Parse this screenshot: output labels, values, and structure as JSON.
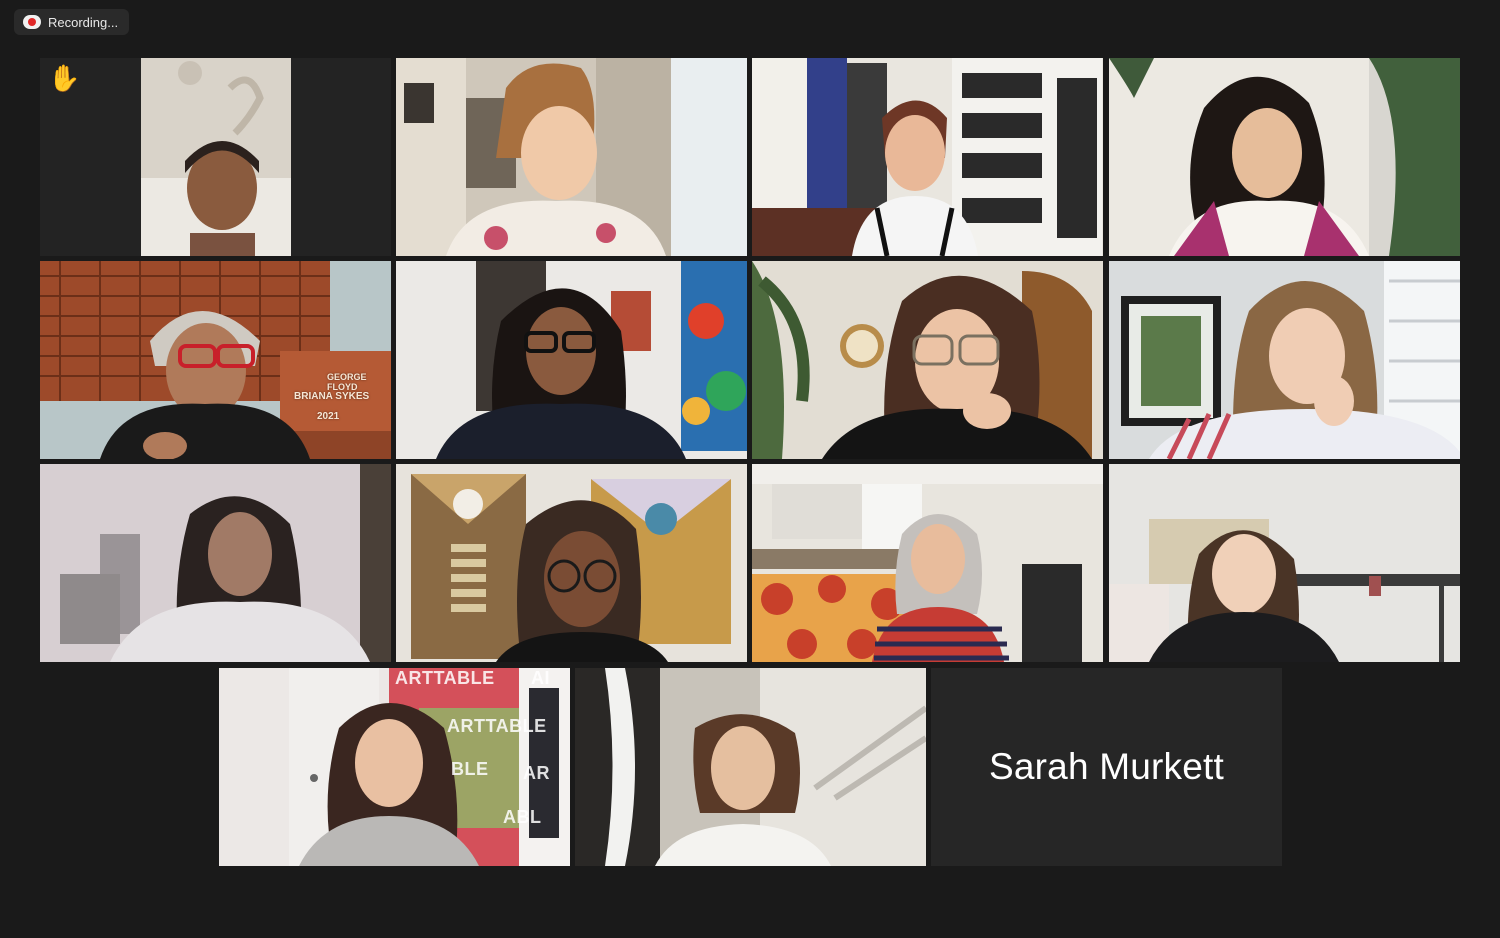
{
  "app": {
    "recording_label": "Recording...",
    "recording_icon": "cloud-recording-icon"
  },
  "gallery": {
    "raised_hand_icon": "raised-hand-icon",
    "active_speaker_color": "#e3e86a",
    "tiles": [
      {
        "id": 1,
        "has_video": true,
        "raised_hand": true
      },
      {
        "id": 2,
        "has_video": true
      },
      {
        "id": 3,
        "has_video": true
      },
      {
        "id": 4,
        "has_video": true
      },
      {
        "id": 5,
        "has_video": true,
        "active_speaker": true,
        "brick_labels": [
          "GEORGE FLOYD",
          "BRIANA SYKES",
          "2021"
        ]
      },
      {
        "id": 6,
        "has_video": true
      },
      {
        "id": 7,
        "has_video": true
      },
      {
        "id": 8,
        "has_video": true
      },
      {
        "id": 9,
        "has_video": true
      },
      {
        "id": 10,
        "has_video": true
      },
      {
        "id": 11,
        "has_video": true
      },
      {
        "id": 12,
        "has_video": true
      },
      {
        "id": 13,
        "has_video": true,
        "banner_texts": [
          "ARTTABLE",
          "ARTTABLE",
          "BLE",
          "ABL",
          "AR",
          "AI"
        ]
      },
      {
        "id": 14,
        "has_video": true
      },
      {
        "id": 15,
        "has_video": false,
        "name": "Sarah Murkett"
      }
    ]
  }
}
